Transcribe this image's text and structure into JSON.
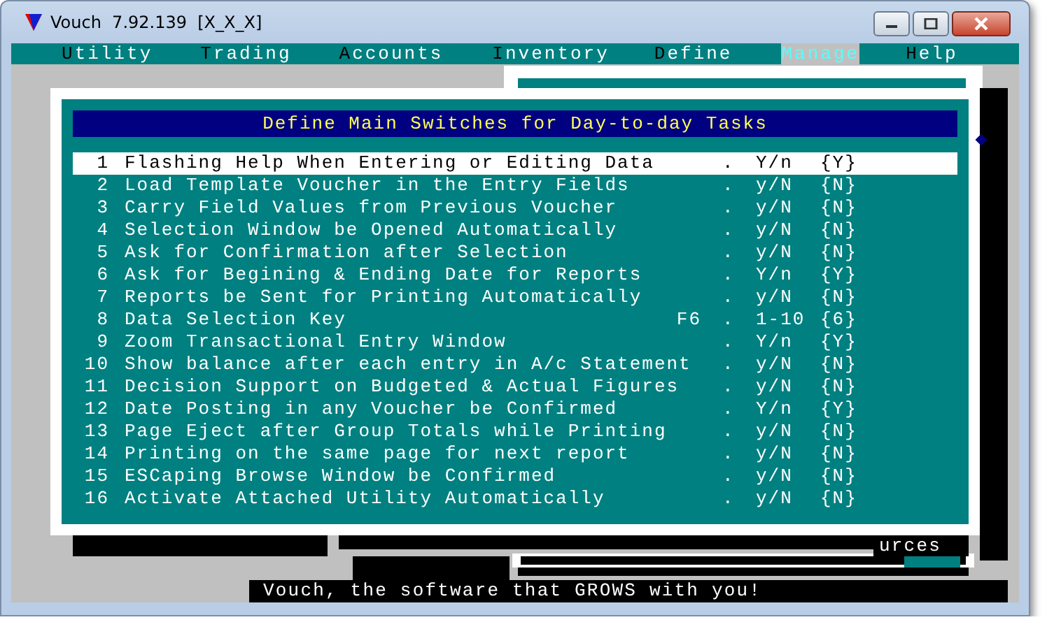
{
  "window": {
    "title": "Vouch  7.92.139  [X_X_X]"
  },
  "menu": [
    {
      "label": "Utility",
      "selected": false
    },
    {
      "label": "Trading",
      "selected": false
    },
    {
      "label": "Accounts",
      "selected": false
    },
    {
      "label": "Inventory",
      "selected": false
    },
    {
      "label": "Define",
      "selected": false
    },
    {
      "label": "Manage",
      "selected": true
    },
    {
      "label": "Help",
      "selected": false
    }
  ],
  "dialog": {
    "title": "Define Main Switches for Day-to-day Tasks",
    "rows": [
      {
        "number": "1",
        "label": "Flashing Help When Entering or Editing Data",
        "leader": ".",
        "option": "Y/n",
        "value": "{Y}",
        "selected": true
      },
      {
        "number": "2",
        "label": "Load Template Voucher in the Entry Fields",
        "leader": ".",
        "option": "y/N",
        "value": "{N}",
        "selected": false
      },
      {
        "number": "3",
        "label": "Carry Field Values from Previous Voucher",
        "leader": ".",
        "option": "y/N",
        "value": "{N}",
        "selected": false
      },
      {
        "number": "4",
        "label": "Selection Window be Opened Automatically",
        "leader": ".",
        "option": "y/N",
        "value": "{N}",
        "selected": false
      },
      {
        "number": "5",
        "label": "Ask for Confirmation after Selection",
        "leader": ".",
        "option": "y/N",
        "value": "{N}",
        "selected": false
      },
      {
        "number": "6",
        "label": "Ask for Begining & Ending Date for Reports",
        "leader": ".",
        "option": "Y/n",
        "value": "{Y}",
        "selected": false
      },
      {
        "number": "7",
        "label": "Reports be Sent for Printing Automatically",
        "leader": ".",
        "option": "y/N",
        "value": "{N}",
        "selected": false
      },
      {
        "number": "8",
        "label": "Data Selection Key",
        "key": "F6",
        "leader": ".",
        "option": "1-10",
        "value": "{6}",
        "selected": false
      },
      {
        "number": "9",
        "label": "Zoom Transactional Entry Window",
        "leader": ".",
        "option": "Y/n",
        "value": "{Y}",
        "selected": false
      },
      {
        "number": "10",
        "label": "Show balance after each entry in A/c Statement",
        "leader": ".",
        "option": "y/N",
        "value": "{N}",
        "selected": false
      },
      {
        "number": "11",
        "label": "Decision Support on Budgeted & Actual Figures",
        "leader": ".",
        "option": "y/N",
        "value": "{N}",
        "selected": false
      },
      {
        "number": "12",
        "label": "Date Posting in any Voucher be Confirmed",
        "leader": ".",
        "option": "Y/n",
        "value": "{Y}",
        "selected": false
      },
      {
        "number": "13",
        "label": "Page Eject after Group Totals while Printing",
        "leader": ".",
        "option": "y/N",
        "value": "{N}",
        "selected": false
      },
      {
        "number": "14",
        "label": "Printing on the same page for next report",
        "leader": ".",
        "option": "y/N",
        "value": "{N}",
        "selected": false
      },
      {
        "number": "15",
        "label": "ESCaping Browse Window be Confirmed",
        "leader": ".",
        "option": "y/N",
        "value": "{N}",
        "selected": false
      },
      {
        "number": "16",
        "label": "Activate Attached Utility Automatically",
        "leader": ".",
        "option": "y/N",
        "value": "{N}",
        "selected": false
      }
    ]
  },
  "background_window": {
    "text": "urces"
  },
  "status_bar": {
    "text": "Vouch, the software that GROWS with you!"
  }
}
